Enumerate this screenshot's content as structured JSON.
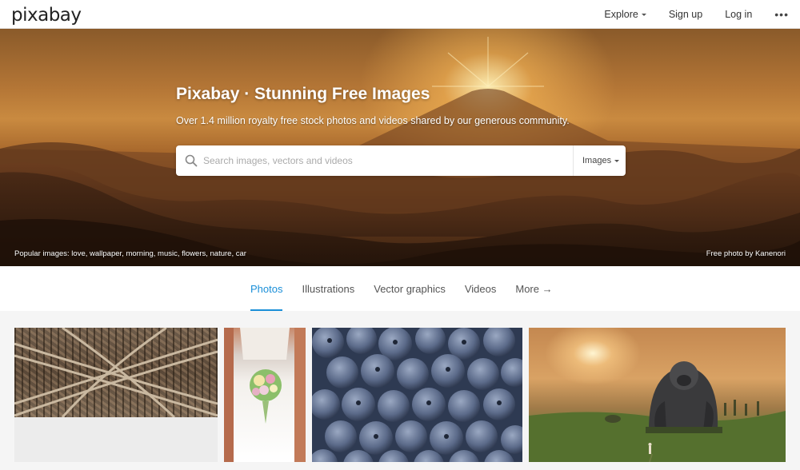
{
  "app": {
    "logo_text": "pixabay"
  },
  "nav": {
    "explore": "Explore",
    "signup": "Sign up",
    "login": "Log in",
    "more": "•••"
  },
  "hero": {
    "title": "Pixabay · Stunning Free Images",
    "subtitle": "Over 1.4 million royalty free stock photos and videos shared by our generous community.",
    "search_placeholder": "Search images, vectors and videos",
    "search_type": "Images",
    "popular_label": "Popular images:",
    "popular_tags": [
      "love",
      "wallpaper",
      "morning",
      "music",
      "flowers",
      "nature",
      "car"
    ],
    "credit": "Free photo by Kanenori"
  },
  "tabs": [
    {
      "label": "Photos",
      "active": true
    },
    {
      "label": "Illustrations",
      "active": false
    },
    {
      "label": "Vector graphics",
      "active": false
    },
    {
      "label": "Videos",
      "active": false
    },
    {
      "label": "More →",
      "active": false
    }
  ],
  "colors": {
    "accent": "#1a8fd8",
    "topbar_bg": "#ffffff",
    "page_bg": "#f5f5f5"
  }
}
